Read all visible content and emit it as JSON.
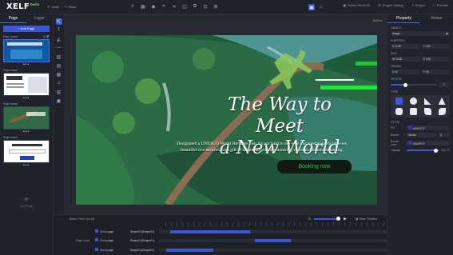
{
  "app": {
    "logo": "XELF",
    "logo_sup": "beta"
  },
  "topbar": {
    "undo": "Undo",
    "redo": "Redo",
    "tools": [
      "text-icon",
      "image-icon",
      "shape-icon",
      "crop-icon",
      "delete-icon",
      "layers-icon",
      "group-icon",
      "ungroup-icon",
      "lock-icon",
      "grid-icon",
      "fullscreen-icon"
    ],
    "saved": "Saved 00:00:00",
    "project_setting": "Project Setting",
    "export": "Export",
    "preview": "Preview"
  },
  "left": {
    "tabs": [
      "Page",
      "Layer"
    ],
    "add_page": "Add Page",
    "pages": [
      {
        "name": "Page name"
      },
      {
        "name": "Page name"
      },
      {
        "name": "Page name"
      },
      {
        "name": "Page name"
      }
    ],
    "add_label": "Add Page"
  },
  "canvas": {
    "zoom": "100%",
    "headline_1": "The Way to Meet",
    "headline_2": "a New World",
    "body_1": "Designated a UNESCO World Heritage Site, it's not hard to see why this spectacularly laid-out,",
    "body_2": "beautiful rice terraces are a gift of nature. Experience amazing views in this unique setting.",
    "button": "Booking now"
  },
  "timeline": {
    "title": "Action Time Line (5)",
    "show_timeline": "Show Timeline",
    "volume": 0.85,
    "rows": [
      {
        "label": "",
        "event": "Go to page",
        "target": "Shape01(Shape01)",
        "bar_start": 0.05,
        "bar_end": 0.4
      },
      {
        "label": "Page Load",
        "event": "Go to page",
        "target": "Shape01(Shape01)",
        "bar_start": 0.42,
        "bar_end": 0.58
      },
      {
        "label": "",
        "event": "Go to page",
        "target": "Shape01(Shape01)",
        "bar_start": 0.03,
        "bar_end": 0.24
      }
    ]
  },
  "right": {
    "tabs": [
      "Property",
      "Action"
    ],
    "object_label": "OBJECT",
    "object_value": "image",
    "position_label": "POSITION",
    "pos_x": "1138",
    "pos_y": "426",
    "size_label": "SIZE",
    "size_w": "1138",
    "size_h": "238",
    "origin_label": "ORIGIN",
    "origin_x": "40",
    "origin_y": "40",
    "rotate_label": "ROTATE",
    "rotate_value": "0",
    "type_label": "TYPE",
    "style_label": "STYLE",
    "fill_label": "Fill",
    "fill_value": "#3A2FCF",
    "border_label": "Border",
    "border_style": "Stroke",
    "border_width": "0",
    "border_color_label": "Border color",
    "border_color_value": "#3A2FCF",
    "opacity_label": "Opacity",
    "opacity_value": "100"
  },
  "colors": {
    "accent": "#3a57d6",
    "green": "#34c15a"
  }
}
